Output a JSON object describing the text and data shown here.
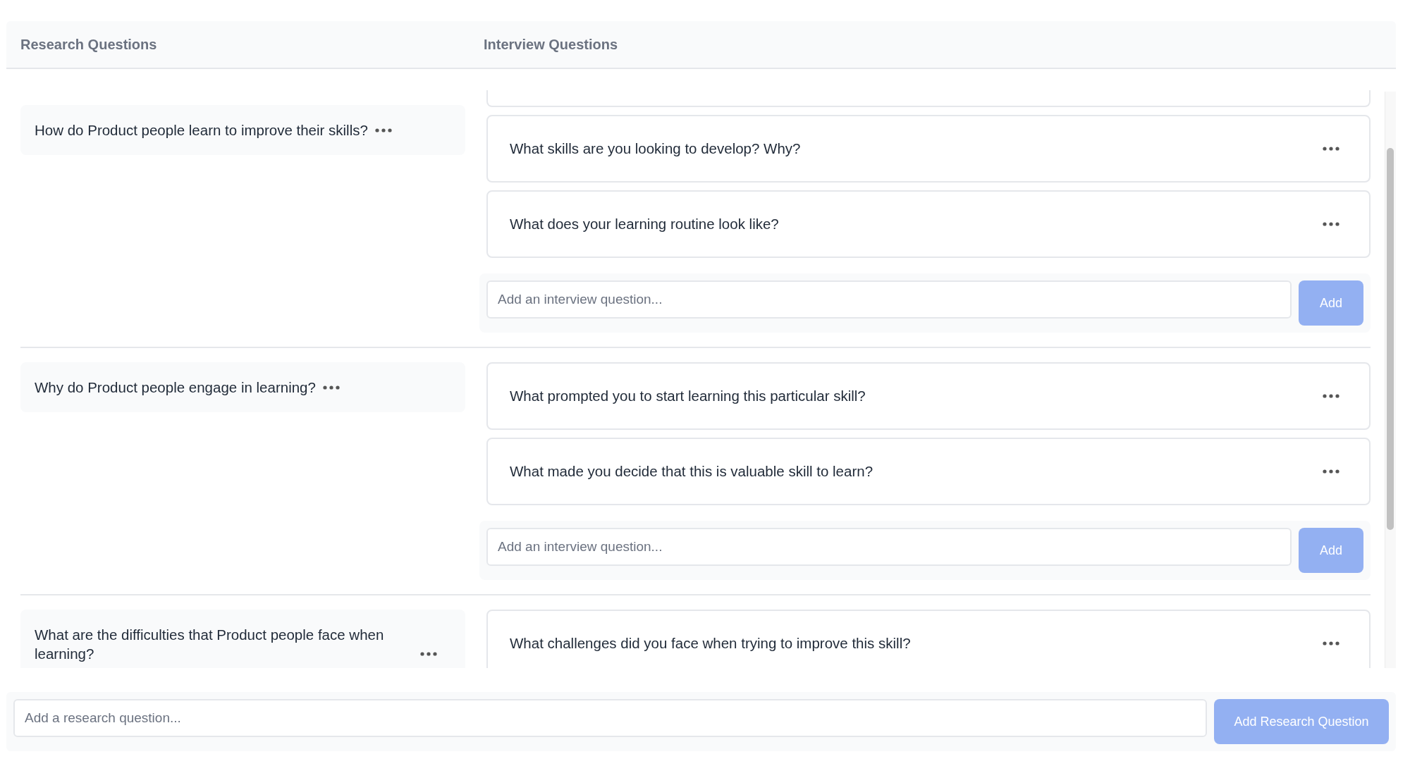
{
  "header": {
    "columns": [
      "Research Questions",
      "Interview Questions"
    ]
  },
  "groups": [
    {
      "clipped_above": true,
      "research_question": "How do Product people learn to improve their skills?",
      "interview_questions": [
        "What skills are you looking to develop? Why?",
        "What does your learning routine look like?"
      ],
      "add_form": {
        "placeholder": "Add an interview question...",
        "button": "Add"
      }
    },
    {
      "clipped_above": false,
      "research_question": "Why do Product people engage in learning?",
      "interview_questions": [
        "What prompted you to start learning this particular skill?",
        "What made you decide that this is valuable skill to learn?"
      ],
      "add_form": {
        "placeholder": "Add an interview question...",
        "button": "Add"
      }
    },
    {
      "clipped_above": false,
      "research_question": "What are the difficulties that Product people face when learning?",
      "interview_questions": [
        "What challenges did you face when trying to improve this skill?"
      ]
    }
  ],
  "footer": {
    "placeholder": "Add a research question...",
    "button": "Add Research Question"
  }
}
